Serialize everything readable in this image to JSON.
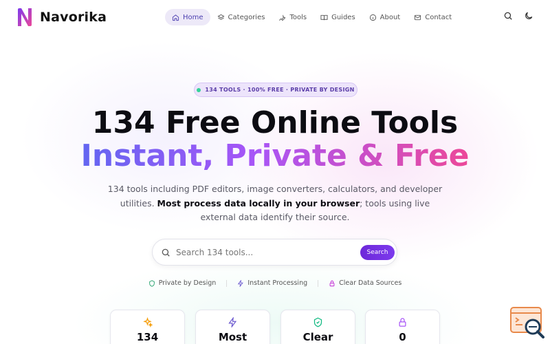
{
  "brand": {
    "name": "Navorika"
  },
  "nav": {
    "items": [
      {
        "label": "Home",
        "icon": "home-icon",
        "active": true
      },
      {
        "label": "Categories",
        "icon": "layers-icon",
        "active": false
      },
      {
        "label": "Tools",
        "icon": "wrench-icon",
        "active": false
      },
      {
        "label": "Guides",
        "icon": "book-icon",
        "active": false
      },
      {
        "label": "About",
        "icon": "info-icon",
        "active": false
      },
      {
        "label": "Contact",
        "icon": "mail-icon",
        "active": false
      }
    ]
  },
  "header_icons": [
    "search-icon",
    "moon-icon"
  ],
  "hero": {
    "badge": "134 TOOLS · 100% FREE · PRIVATE BY DESIGN",
    "title_line1": "134 Free Online Tools",
    "title_line2": "Instant, Private & Free",
    "desc_part1": "134 tools including PDF editors, image converters, calculators, and developer utilities. ",
    "desc_bold": "Most process data locally in your browser",
    "desc_part2": "; tools using live external data identify their source."
  },
  "search": {
    "placeholder": "Search 134 tools...",
    "button_label": "Search"
  },
  "features": [
    {
      "label": "Private by Design",
      "icon": "shield-icon"
    },
    {
      "label": "Instant Processing",
      "icon": "zap-icon"
    },
    {
      "label": "Clear Data Sources",
      "icon": "lock-icon"
    }
  ],
  "stats": [
    {
      "value": "134",
      "icon": "sparkles-icon"
    },
    {
      "value": "Most",
      "icon": "zap-icon"
    },
    {
      "value": "Clear",
      "icon": "shield-check-icon"
    },
    {
      "value": "0",
      "icon": "lock-icon"
    }
  ],
  "colors": {
    "accent": "#7c3aed",
    "active_nav_bg": "#ede9f8",
    "gradient_start": "#6366f1",
    "gradient_mid": "#a855f7",
    "gradient_end": "#ec4899",
    "badge_dot": "#34d399"
  }
}
